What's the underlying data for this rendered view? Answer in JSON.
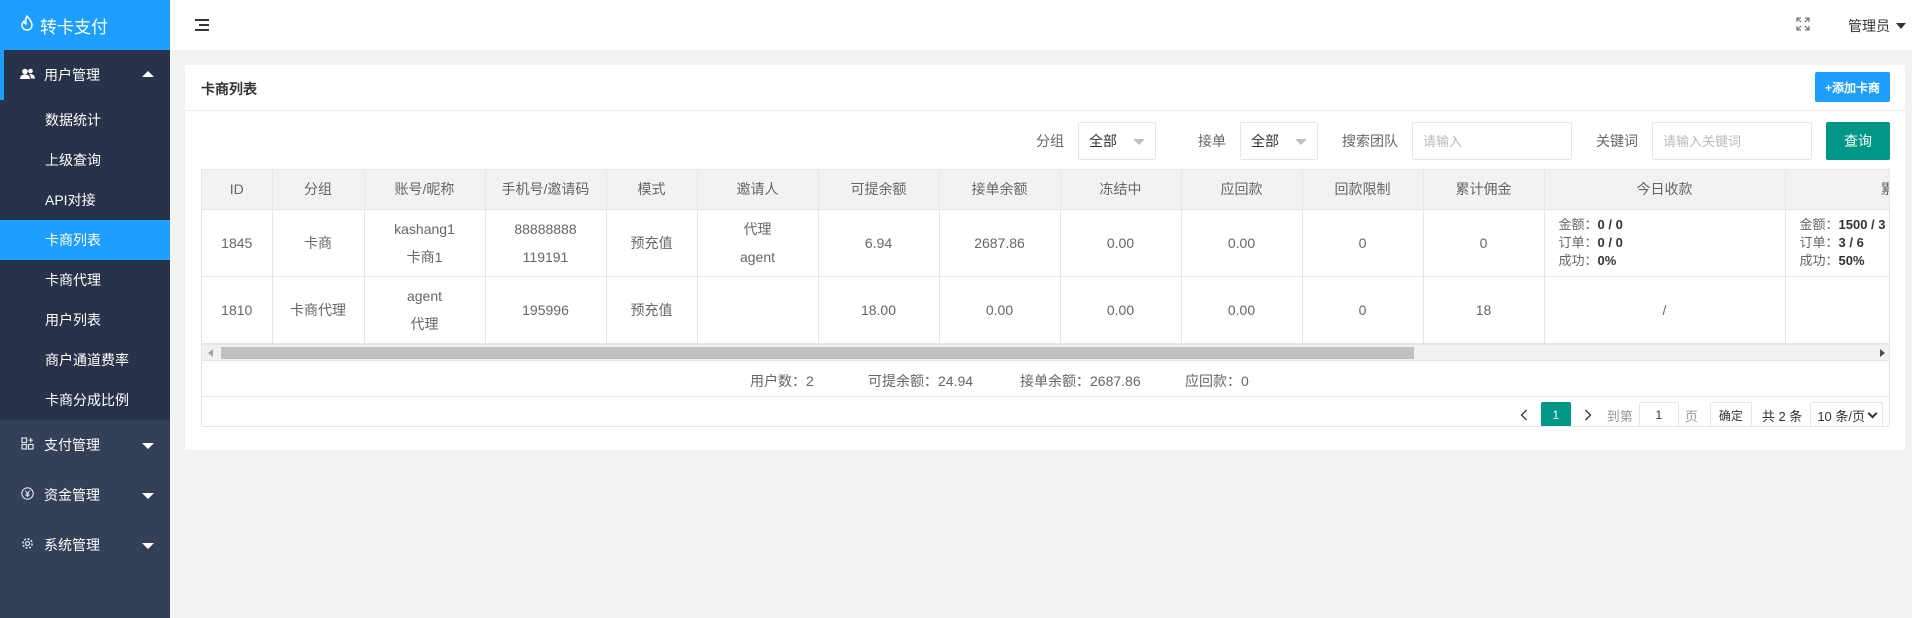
{
  "brand": {
    "logo_icon": "flame-icon",
    "title": "转卡支付"
  },
  "sidebar": {
    "groups": [
      {
        "label": "用户管理",
        "icon": "users-icon",
        "open": true,
        "items": [
          "数据统计",
          "上级查询",
          "API对接",
          "卡商列表",
          "卡商代理",
          "用户列表",
          "商户通道费率",
          "卡商分成比例"
        ],
        "active": "卡商列表"
      },
      {
        "label": "支付管理",
        "icon": "payment-icon",
        "open": false
      },
      {
        "label": "资金管理",
        "icon": "yen-icon",
        "open": false
      },
      {
        "label": "系统管理",
        "icon": "settings-icon",
        "open": false
      }
    ]
  },
  "header": {
    "user": "管理员"
  },
  "page": {
    "title": "卡商列表",
    "add_button": "+添加卡商"
  },
  "filters": {
    "group_label": "分组",
    "group_value": "全部",
    "order_label": "接单",
    "order_value": "全部",
    "team_label": "搜索团队",
    "team_placeholder": "请输入",
    "keyword_label": "关键词",
    "keyword_placeholder": "请输入关键词",
    "query_button": "查询"
  },
  "table": {
    "columns": [
      "ID",
      "分组",
      "账号/昵称",
      "手机号/邀请码",
      "模式",
      "邀请人",
      "可提余额",
      "接单余额",
      "冻结中",
      "应回款",
      "回款限制",
      "累计佣金",
      "今日收款",
      "累"
    ],
    "rows": [
      {
        "id": "1845",
        "group": "卡商",
        "account": "kashang1",
        "nickname": "卡商1",
        "phone": "88888888",
        "invite_code": "119191",
        "mode": "预充值",
        "inviter": "代理",
        "inviter_sub": "agent",
        "withdrawable": "6.94",
        "order_balance": "2687.86",
        "frozen": "0.00",
        "receivable": "0.00",
        "limit": "0",
        "commission": "0",
        "today": {
          "amount_label": "金额：",
          "amount": "0 / 0",
          "orders_label": "订单：",
          "orders": "0 / 0",
          "success_label": "成功：",
          "success": "0%"
        },
        "total": {
          "amount_label": "金额：",
          "amount": "1500 / 3",
          "orders_label": "订单：",
          "orders": "3 / 6",
          "success_label": "成功：",
          "success": "50%"
        }
      },
      {
        "id": "1810",
        "group": "卡商代理",
        "account": "agent",
        "nickname": "代理",
        "phone": "195996",
        "invite_code": "",
        "mode": "预充值",
        "inviter": "",
        "inviter_sub": "",
        "withdrawable": "18.00",
        "order_balance": "0.00",
        "frozen": "0.00",
        "receivable": "0.00",
        "limit": "0",
        "commission": "18",
        "today_text": "/",
        "total_text": ""
      }
    ]
  },
  "summary": {
    "users": "用户数：2",
    "withdrawable": "可提余额：24.94",
    "order_balance": "接单余额：2687.86",
    "receivable": "应回款：0"
  },
  "pager": {
    "current": "1",
    "goto_label": "到第",
    "goto_value": "1",
    "page_unit": "页",
    "confirm": "确定",
    "total": "共 2 条",
    "page_size": "10 条/页"
  },
  "colors": {
    "primary": "#1e9fff",
    "teal": "#009688",
    "sidebar": "#344058",
    "sidebar_dark": "#28334a"
  }
}
